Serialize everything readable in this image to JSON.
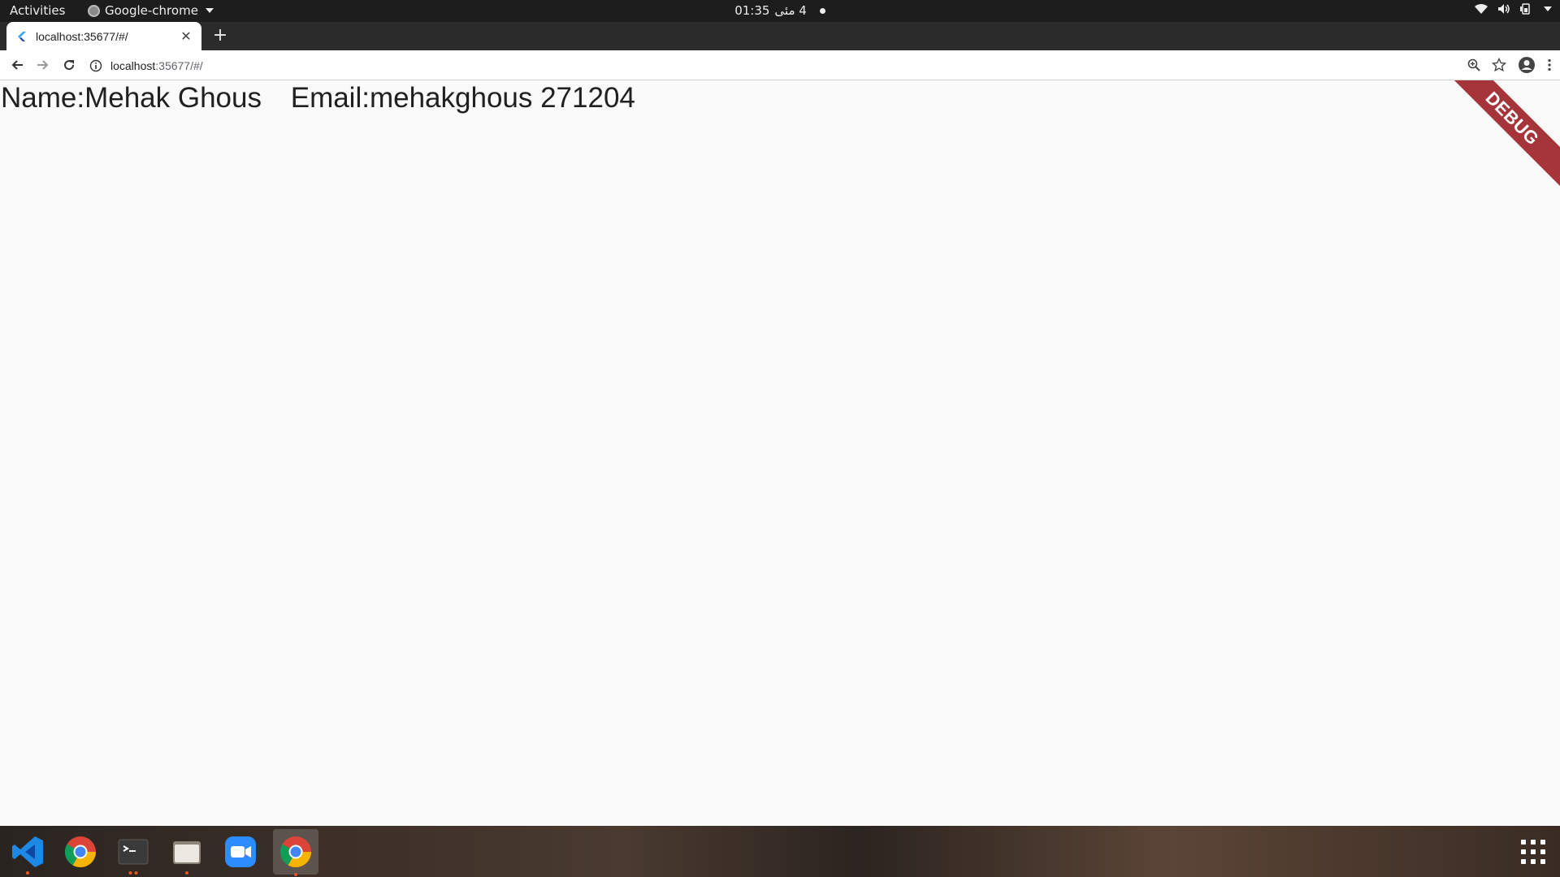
{
  "topbar": {
    "activities": "Activities",
    "app_name": "Google-chrome",
    "time": "01:35",
    "date": "4 مئی"
  },
  "browser": {
    "tab_title": "localhost:35677/#/",
    "url_host": "localhost",
    "url_rest": ":35677/#/"
  },
  "page": {
    "name_text": "Name:Mehak Ghous",
    "email_text": "Email:mehakghous 271204",
    "debug_banner": "DEBUG",
    "debug_color": "#a5353b"
  },
  "dock": {
    "items": [
      {
        "icon": "vscode-icon"
      },
      {
        "icon": "chrome-icon"
      },
      {
        "icon": "terminal-icon"
      },
      {
        "icon": "files-icon"
      },
      {
        "icon": "zoom-icon"
      },
      {
        "icon": "chrome-icon",
        "active": true
      }
    ]
  }
}
